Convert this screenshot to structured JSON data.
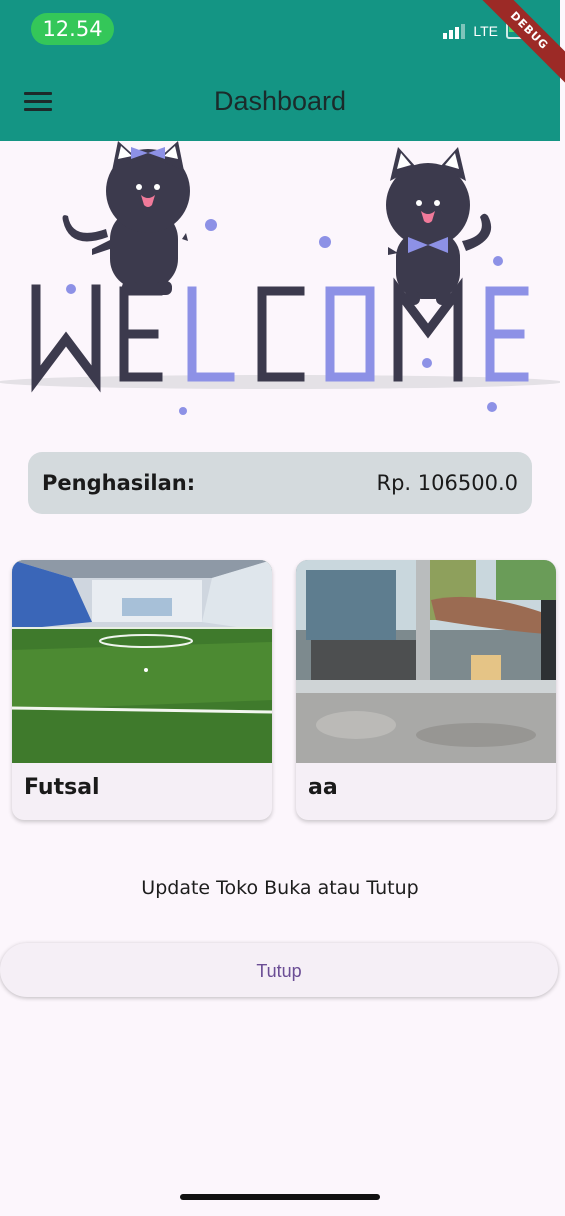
{
  "status_bar": {
    "time": "12.54",
    "network": "LTE",
    "debug_banner": "DEBUG"
  },
  "app_bar": {
    "title": "Dashboard",
    "menu_icon": "menu-icon"
  },
  "welcome_banner": {
    "text": "WELCOME"
  },
  "income": {
    "label": "Penghasilan:",
    "value": "Rp. 106500.0"
  },
  "items": [
    {
      "title": "Futsal",
      "image": "futsal-field-photo"
    },
    {
      "title": "aa",
      "image": "food-stall-photo"
    }
  ],
  "store_status": {
    "prompt": "Update Toko Buka atau Tutup",
    "button_label": "Tutup"
  },
  "colors": {
    "app_bar": "#149584",
    "background": "#fcf6fc",
    "accent_purple": "#8d91e6",
    "dark_letters": "#3c3a4d"
  }
}
